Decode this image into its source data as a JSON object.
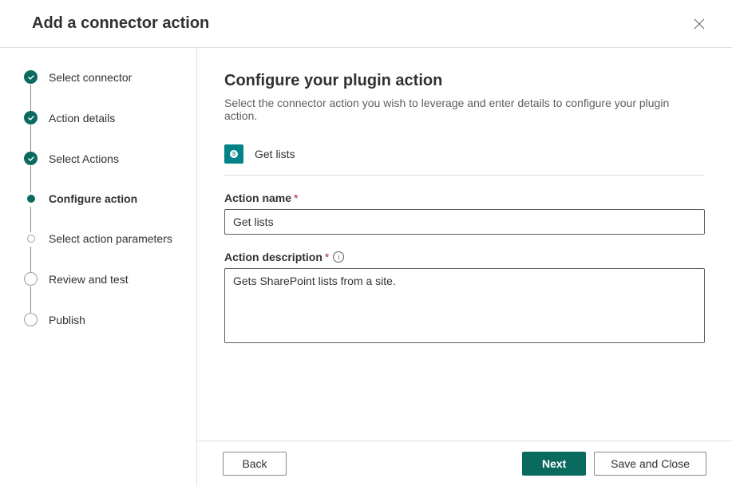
{
  "header": {
    "title": "Add a connector action"
  },
  "stepper": {
    "steps": [
      {
        "label": "Select connector",
        "state": "completed"
      },
      {
        "label": "Action details",
        "state": "completed"
      },
      {
        "label": "Select Actions",
        "state": "completed"
      },
      {
        "label": "Configure action",
        "state": "current"
      },
      {
        "label": "Select action parameters",
        "state": "small-open"
      },
      {
        "label": "Review and test",
        "state": "open"
      },
      {
        "label": "Publish",
        "state": "open"
      }
    ]
  },
  "main": {
    "title": "Configure your plugin action",
    "subtitle": "Select the connector action you wish to leverage and enter details to configure your plugin action.",
    "connector": {
      "icon_text": "S",
      "name": "Get lists"
    },
    "fields": {
      "action_name": {
        "label": "Action name",
        "value": "Get lists"
      },
      "action_description": {
        "label": "Action description",
        "value": "Gets SharePoint lists from a site."
      }
    }
  },
  "footer": {
    "back": "Back",
    "next": "Next",
    "save_close": "Save and Close"
  }
}
